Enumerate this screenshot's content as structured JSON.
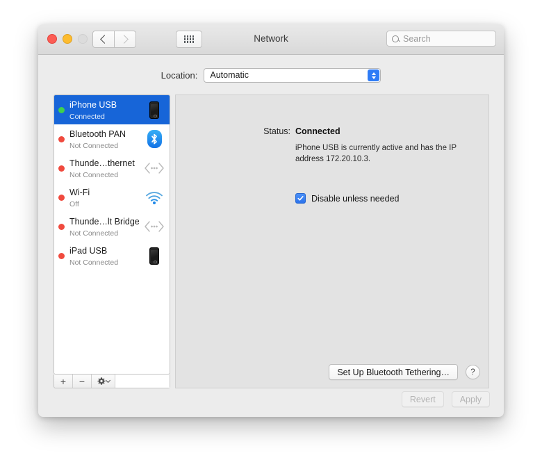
{
  "window": {
    "title": "Network",
    "traffic_lights": [
      "close",
      "minimize",
      "zoom-disabled"
    ],
    "nav": {
      "back": "back-icon",
      "forward": "forward-icon",
      "grid": "grid-view-icon"
    },
    "search": {
      "placeholder": "Search",
      "value": "",
      "icon": "search-icon"
    }
  },
  "location": {
    "label": "Location:",
    "value": "Automatic",
    "options": [
      "Automatic"
    ]
  },
  "sidebar": {
    "services": [
      {
        "name": "iPhone USB",
        "state": "Connected",
        "status_color": "#3ed14e",
        "icon": "iphone-icon",
        "selected": true
      },
      {
        "name": "Bluetooth PAN",
        "state": "Not Connected",
        "status_color": "#f04a3e",
        "icon": "bluetooth-icon",
        "selected": false
      },
      {
        "name": "Thunde…thernet",
        "state": "Not Connected",
        "status_color": "#f04a3e",
        "icon": "thunderbolt-icon",
        "selected": false
      },
      {
        "name": "Wi-Fi",
        "state": "Off",
        "status_color": "#f04a3e",
        "icon": "wifi-icon",
        "selected": false
      },
      {
        "name": "Thunde…lt Bridge",
        "state": "Not Connected",
        "status_color": "#f04a3e",
        "icon": "thunderbolt-icon",
        "selected": false
      },
      {
        "name": "iPad USB",
        "state": "Not Connected",
        "status_color": "#f04a3e",
        "icon": "ipad-icon",
        "selected": false
      }
    ],
    "toolbar": {
      "add": "+",
      "remove": "−",
      "actions": "gear-icon"
    }
  },
  "detail": {
    "status_label": "Status:",
    "status_value": "Connected",
    "description": "iPhone USB is currently active and has the IP address 172.20.10.3.",
    "checkbox": {
      "label": "Disable unless needed",
      "checked": true
    },
    "setup_button": "Set Up Bluetooth Tethering…",
    "help_button": "?"
  },
  "footer": {
    "revert": "Revert",
    "apply": "Apply",
    "revert_enabled": false,
    "apply_enabled": false
  },
  "colors": {
    "selection_blue": "#1765d8",
    "accent_blue": "#2f7cf6",
    "connected_green": "#3ed14e",
    "disconnected_red": "#f04a3e",
    "panel_gray": "#e3e3e3",
    "window_gray": "#ececec"
  }
}
